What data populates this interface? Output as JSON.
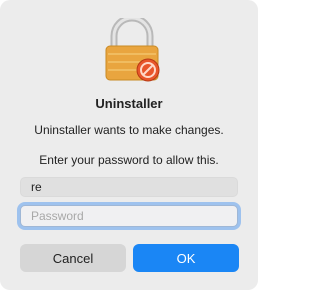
{
  "dialog": {
    "icon": "lock-icon",
    "title": "Uninstaller",
    "message": "Uninstaller wants to make changes.",
    "prompt": "Enter your password to allow this.",
    "username_value": "re",
    "password_placeholder": "Password",
    "cancel_label": "Cancel",
    "ok_label": "OK"
  },
  "colors": {
    "accent": "#1a86f5",
    "background": "#ececec",
    "badge": "#e8562a"
  }
}
